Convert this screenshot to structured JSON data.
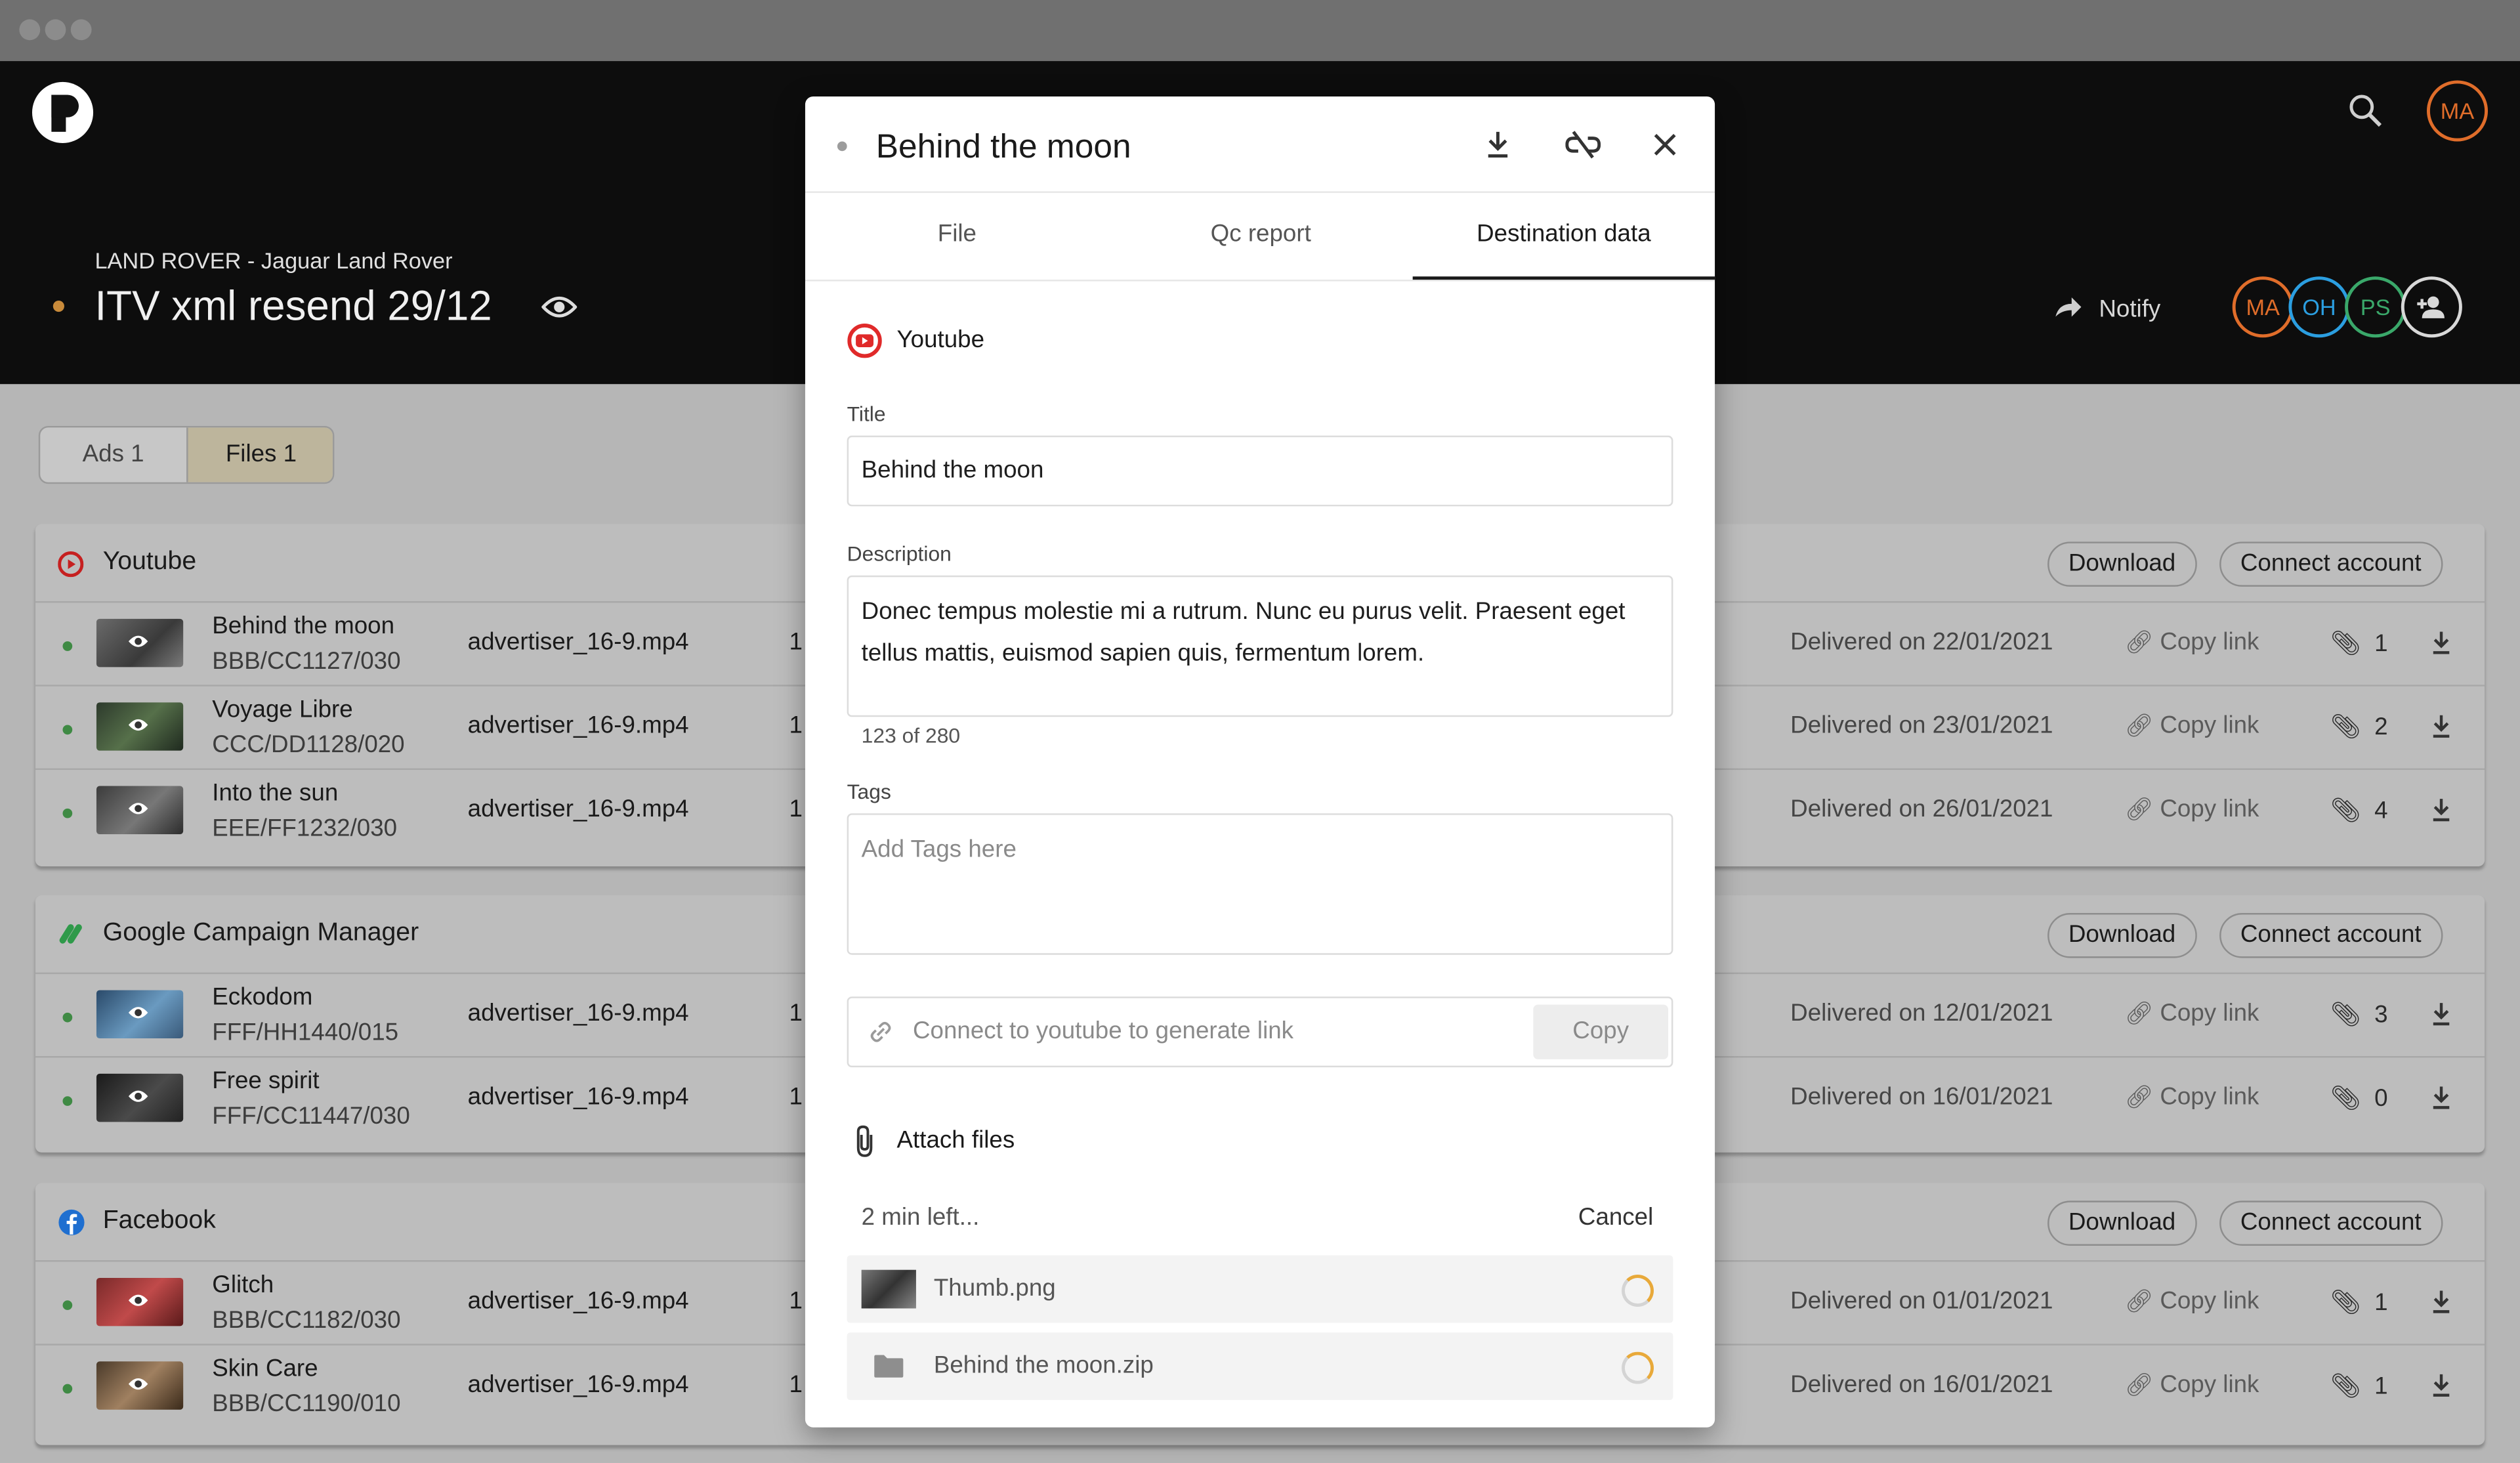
{
  "header": {
    "breadcrumb": "LAND ROVER - Jaguar Land Rover",
    "title": "ITV xml resend 29/12",
    "notify_label": "Notify",
    "user_avatar": "MA",
    "members": [
      {
        "initials": "MA",
        "color": "#e06d2a"
      },
      {
        "initials": "OH",
        "color": "#2b9ee0"
      },
      {
        "initials": "PS",
        "color": "#3aa86a"
      }
    ]
  },
  "view_toggle": {
    "ads": "Ads 1",
    "files": "Files 1"
  },
  "groups": [
    {
      "name": "Youtube",
      "download": "Download",
      "connect": "Connect account",
      "rows": [
        {
          "name": "Behind the moon",
          "code": "BBB/CC1127/030",
          "file": "advertiser_16-9.mp4",
          "col": "1",
          "delivered": "Delivered on 22/01/2021",
          "copy": "Copy link",
          "count": "1"
        },
        {
          "name": "Voyage Libre",
          "code": "CCC/DD1128/020",
          "file": "advertiser_16-9.mp4",
          "col": "1",
          "delivered": "Delivered on 23/01/2021",
          "copy": "Copy link",
          "count": "2"
        },
        {
          "name": "Into the sun",
          "code": "EEE/FF1232/030",
          "file": "advertiser_16-9.mp4",
          "col": "1",
          "delivered": "Delivered on 26/01/2021",
          "copy": "Copy link",
          "count": "4"
        }
      ]
    },
    {
      "name": "Google Campaign Manager",
      "download": "Download",
      "connect": "Connect account",
      "rows": [
        {
          "name": "Eckodom",
          "code": "FFF/HH1440/015",
          "file": "advertiser_16-9.mp4",
          "col": "1",
          "delivered": "Delivered on 12/01/2021",
          "copy": "Copy link",
          "count": "3"
        },
        {
          "name": "Free spirit",
          "code": "FFF/CC11447/030",
          "file": "advertiser_16-9.mp4",
          "col": "1",
          "delivered": "Delivered on 16/01/2021",
          "copy": "Copy link",
          "count": "0"
        }
      ]
    },
    {
      "name": "Facebook",
      "download": "Download",
      "connect": "Connect account",
      "rows": [
        {
          "name": "Glitch",
          "code": "BBB/CC1182/030",
          "file": "advertiser_16-9.mp4",
          "col": "1",
          "delivered": "Delivered on 01/01/2021",
          "copy": "Copy link",
          "count": "1"
        },
        {
          "name": "Skin Care",
          "code": "BBB/CC1190/010",
          "file": "advertiser_16-9.mp4",
          "col": "1",
          "delivered": "Delivered on 16/01/2021",
          "copy": "Copy link",
          "count": "1"
        }
      ]
    }
  ],
  "modal": {
    "title": "Behind the moon",
    "tabs": [
      "File",
      "Qc report",
      "Destination data"
    ],
    "active_tab": "Destination data",
    "destination": "Youtube",
    "title_label": "Title",
    "title_value": "Behind the moon",
    "description_label": "Description",
    "description_value": "Donec tempus molestie mi a rutrum. Nunc eu purus velit. Praesent eget tellus mattis, euismod sapien quis, fermentum lorem.",
    "char_count": "123 of 280",
    "tags_label": "Tags",
    "tags_placeholder": "Add Tags here",
    "link_placeholder": "Connect to youtube to generate link",
    "copy_label": "Copy",
    "attach_label": "Attach files",
    "time_left": "2 min left...",
    "cancel_label": "Cancel",
    "uploads": [
      "Thumb.png",
      "Behind the moon.zip"
    ]
  },
  "colors": {
    "accent": "#e02a2a",
    "header_bg": "#0d0d0d",
    "delivered_dot": "#3f8a44"
  }
}
